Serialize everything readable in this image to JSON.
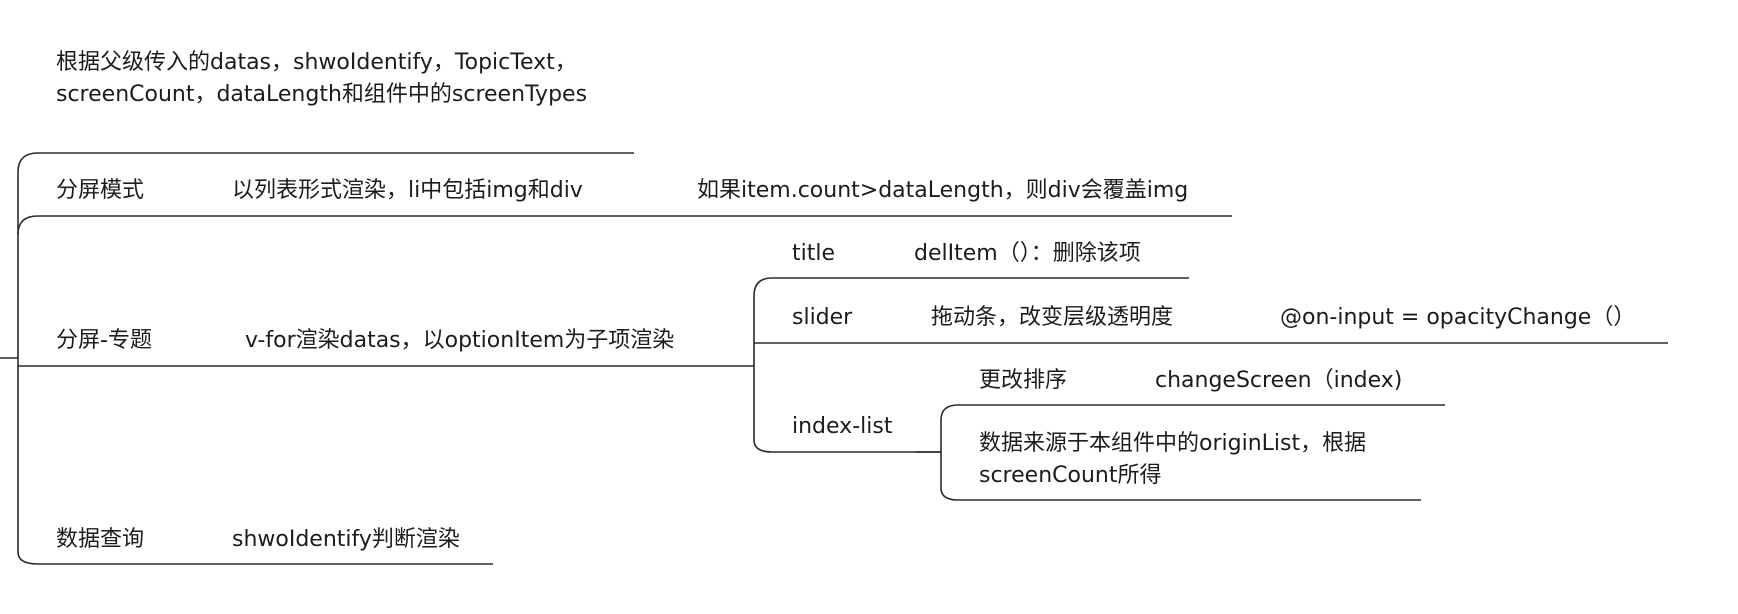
{
  "colors": {
    "line": "#2b2b2b",
    "text": "#1c1c1c",
    "background": "#ffffff"
  },
  "nodes": {
    "root_desc": "根据父级传入的datas，shwoIdentify，TopicText，screenCount，dataLength和组件中的screenTypes",
    "split_mode": {
      "label": "分屏模式",
      "render": "以列表形式渲染，li中包括img和div",
      "cover": "如果item.count>dataLength，则div会覆盖img"
    },
    "split_topic": {
      "label": "分屏-专题",
      "render": "v-for渲染datas，以optionItem为子项渲染",
      "title": {
        "label": "title",
        "desc": "delItem（）：删除该项"
      },
      "slider": {
        "label": "slider",
        "desc": "拖动条，改变层级透明度",
        "event": "@on-input = opacityChange（）"
      },
      "index_list": {
        "label": "index-list",
        "sort": "更改排序",
        "sort_fn": "changeScreen（index)",
        "source": "数据来源于本组件中的originList，根据screenCount所得"
      }
    },
    "data_query": {
      "label": "数据查询",
      "render": "shwoIdentify判断渲染"
    }
  }
}
